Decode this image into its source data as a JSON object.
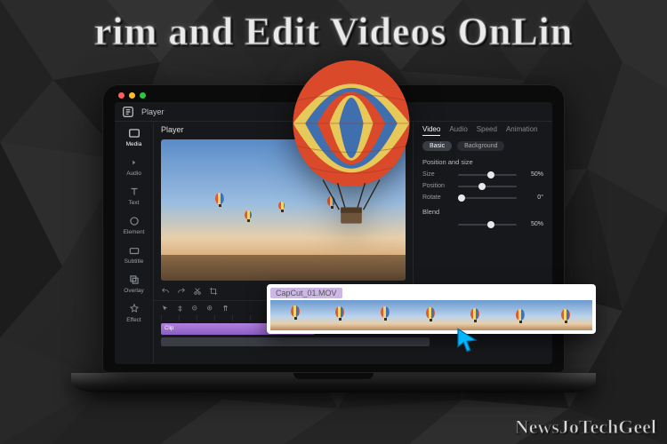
{
  "headline": "rim and Edit Videos OnLin",
  "watermark": "NewsJoTechGeel",
  "editor": {
    "player_label": "Player",
    "tools": [
      {
        "id": "media",
        "label": "Media"
      },
      {
        "id": "audio",
        "label": "Audio"
      },
      {
        "id": "text",
        "label": "Text"
      },
      {
        "id": "element",
        "label": "Element"
      },
      {
        "id": "subtitle",
        "label": "Subtitle"
      },
      {
        "id": "overlay",
        "label": "Overlay"
      },
      {
        "id": "effect",
        "label": "Effect"
      }
    ],
    "right_panel": {
      "tabs": [
        "Video",
        "Audio",
        "Speed",
        "Animation"
      ],
      "active_tab": "Video",
      "subtabs": {
        "basic": "Basic",
        "background": "Background"
      },
      "section_position": "Position and size",
      "rows": [
        {
          "label": "Size",
          "value": "50%",
          "knob_pct": 50
        },
        {
          "label": "Position",
          "value": "",
          "knob_pct": 35
        },
        {
          "label": "Rotate",
          "value": "0°",
          "knob_pct": 0
        }
      ],
      "section_blend": "Blend",
      "blend_row": {
        "label": "",
        "value": "50%",
        "knob_pct": 50
      }
    },
    "timeline": {
      "clip_label": "Clip"
    }
  },
  "filmstrip": {
    "filename": "CapCut_01.MOV",
    "frame_count": 7
  },
  "colors": {
    "accent_purple": "#9b72d4",
    "panel_bg": "#17181b",
    "highlight_blue": "#00b7ff"
  }
}
